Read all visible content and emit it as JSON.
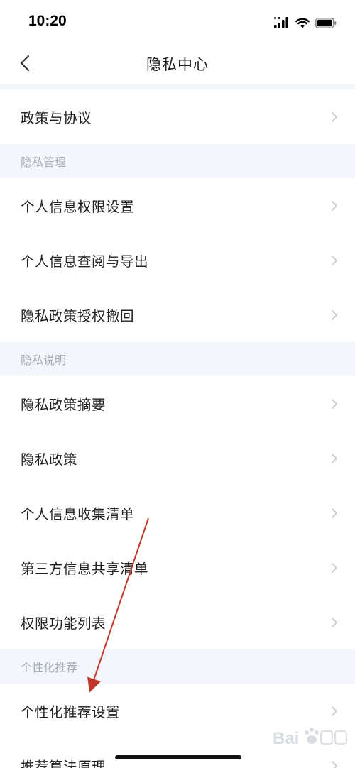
{
  "status_bar": {
    "time": "10:20"
  },
  "nav": {
    "title": "隐私中心"
  },
  "sections": {
    "top_items": [
      {
        "label": "政策与协议"
      }
    ],
    "privacy_management": {
      "header": "隐私管理",
      "items": [
        {
          "label": "个人信息权限设置"
        },
        {
          "label": "个人信息查阅与导出"
        },
        {
          "label": "隐私政策授权撤回"
        }
      ]
    },
    "privacy_explanation": {
      "header": "隐私说明",
      "items": [
        {
          "label": "隐私政策摘要"
        },
        {
          "label": "隐私政策"
        },
        {
          "label": "个人信息收集清单"
        },
        {
          "label": "第三方信息共享清单"
        },
        {
          "label": "权限功能列表"
        }
      ]
    },
    "personalized": {
      "header": "个性化推荐",
      "items": [
        {
          "label": "个性化推荐设置"
        },
        {
          "label": "推荐算法原理"
        }
      ]
    }
  },
  "colors": {
    "section_bg": "#f3f6fa",
    "section_text": "#a5acb5",
    "chevron": "#c4c8cd",
    "annotation_arrow": "#c0392b"
  },
  "icons": {
    "back": "chevron-left-icon",
    "row": "chevron-right-icon",
    "signal": "cellular-signal-icon",
    "wifi": "wifi-icon",
    "battery": "battery-icon"
  },
  "watermark": {
    "text": "Bai 经验",
    "type": "logo"
  }
}
